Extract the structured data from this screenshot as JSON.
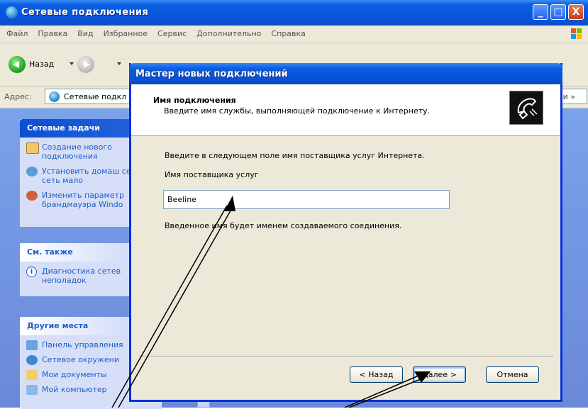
{
  "window": {
    "title": "Сетевые подключения",
    "controls": [
      "_",
      "□",
      "X"
    ]
  },
  "menu": [
    "Файл",
    "Правка",
    "Вид",
    "Избранное",
    "Сервис",
    "Дополнительно",
    "Справка"
  ],
  "toolbar": {
    "back_label": "Назад"
  },
  "address": {
    "label": "Адрес:",
    "value": "Сетевые подкл",
    "right_text": "ки »"
  },
  "sidebar": {
    "network_tasks": {
      "title": "Сетевые задачи",
      "items": [
        {
          "label": "Создание нового подключения",
          "icon": "new-connection-icon"
        },
        {
          "label": "Установить домаш сеть или сеть мало",
          "icon": "home-network-icon"
        },
        {
          "label": "Изменить параметр брандмауэра Windo",
          "icon": "firewall-icon"
        }
      ]
    },
    "see_also": {
      "title": "См. также",
      "items": [
        {
          "label": "Диагностика сетев неполадок",
          "icon": "info-icon"
        }
      ]
    },
    "other_places": {
      "title": "Другие места",
      "items": [
        {
          "label": "Панель управления",
          "icon": "control-panel-icon"
        },
        {
          "label": "Сетевое окружени",
          "icon": "network-places-icon"
        },
        {
          "label": "Мои документы",
          "icon": "folder-icon"
        },
        {
          "label": "Мой компьютер",
          "icon": "computer-icon"
        }
      ]
    }
  },
  "wizard": {
    "title": "Мастер новых подключений",
    "header_title": "Имя подключения",
    "header_subtitle": "Введите имя службы, выполняющей подключение к Интернету.",
    "instruction": "Введите в следующем поле имя поставщика услуг Интернета.",
    "field_label": "Имя поставщика услуг",
    "field_value": "Beeline",
    "note": "Введенное имя будет именем создаваемого соединения.",
    "buttons": {
      "back": "< Назад",
      "next": "Далее >",
      "cancel": "Отмена"
    }
  },
  "colors": {
    "xp_blue": "#0a5fe0",
    "task_pane": "#6a89d9",
    "dialog_bg": "#ece9d8"
  }
}
